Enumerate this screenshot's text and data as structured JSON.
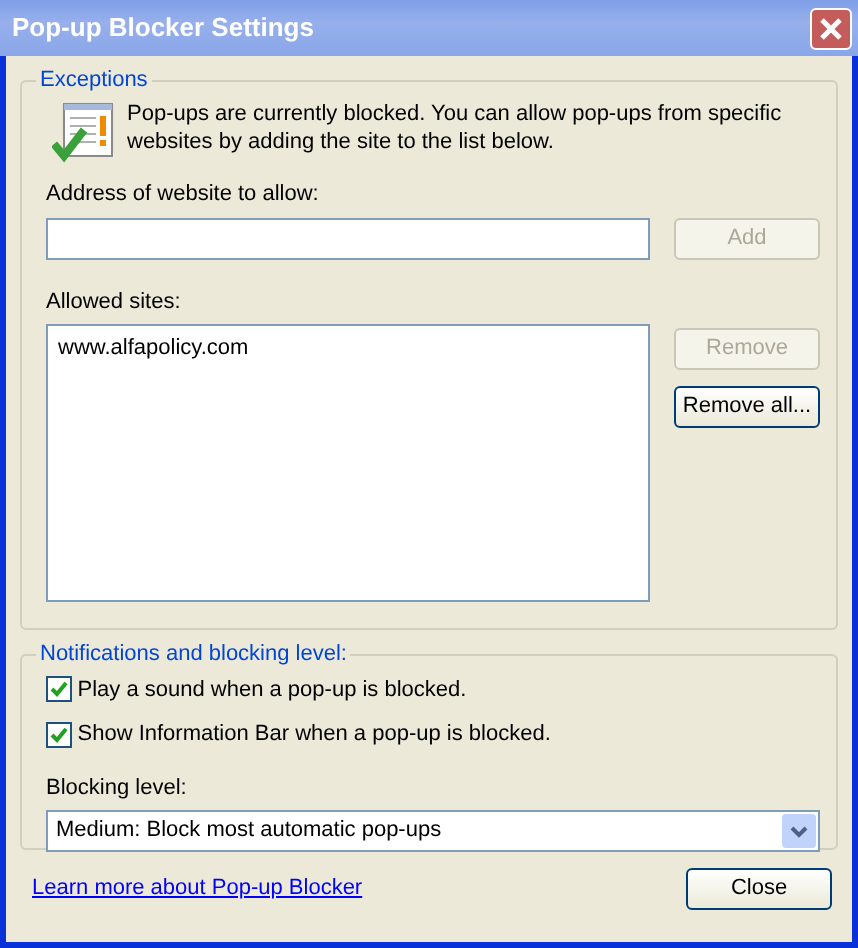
{
  "window": {
    "title": "Pop-up Blocker Settings"
  },
  "exceptions": {
    "legend": "Exceptions",
    "description": "Pop-ups are currently blocked.  You can allow pop-ups from specific websites by adding the site to the list below.",
    "address_label": "Address of website to allow:",
    "add_button": {
      "label": "Add",
      "disabled": true
    },
    "allowed_label": "Allowed sites:",
    "allowed_sites": [
      {
        "text": "www.alfapolicy.com",
        "selected": false
      }
    ],
    "list_buttons": [
      {
        "label": "Remove",
        "disabled": true
      },
      {
        "label": "Remove all...",
        "disabled": false
      }
    ]
  },
  "notifications": {
    "legend": "Notifications and blocking level:",
    "options": [
      {
        "label": "Play a sound when a pop-up is blocked.",
        "checked": true
      },
      {
        "label": "Show Information Bar when a pop-up is blocked.",
        "checked": true
      }
    ],
    "blocking_label": "Blocking level:",
    "blocking_level": "Medium: Block most automatic pop-ups"
  },
  "footer": {
    "link": "Learn more about Pop-up Blocker",
    "close_button": "Close"
  }
}
